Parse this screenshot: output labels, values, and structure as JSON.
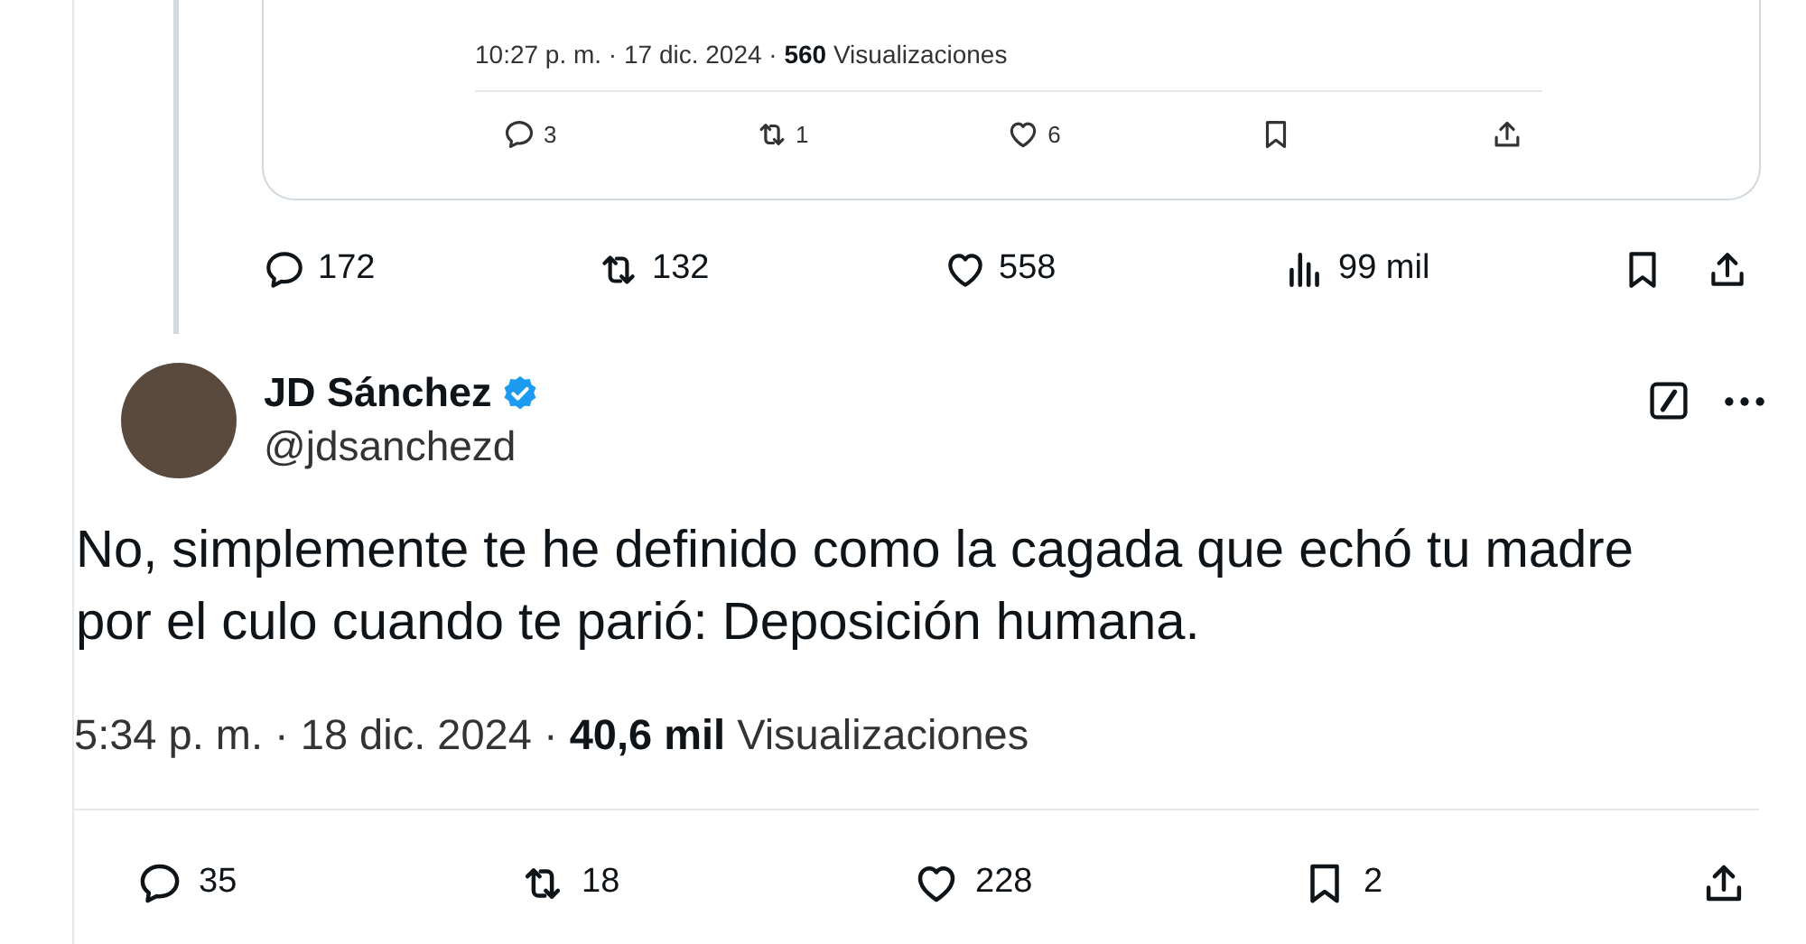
{
  "quoted_tweet": {
    "meta": "10:27 p. m. · 17 dic. 2024 · **560** Visualizaciones",
    "actions": [
      {
        "kind": "reply",
        "count": "3"
      },
      {
        "kind": "repost",
        "count": "1"
      },
      {
        "kind": "like",
        "count": "6"
      },
      {
        "kind": "bookmark"
      },
      {
        "kind": "share"
      }
    ]
  },
  "parent_actions": [
    {
      "kind": "reply",
      "count": "172"
    },
    {
      "kind": "repost",
      "count": "132"
    },
    {
      "kind": "like",
      "count": "558"
    },
    {
      "kind": "views",
      "count": "99 mil"
    },
    {
      "kind": "bookmark"
    },
    {
      "kind": "share"
    }
  ],
  "reply": {
    "name": "JD Sánchez",
    "verified": true,
    "handle": "@jdsanchezd",
    "text": "No, simplemente te he definido como la cagada que echó tu madre por el culo cuando te parió: Deposición humana.",
    "meta": "5:34 p. m. · 18 dic. 2024 · **40,6 mil** Visualizaciones",
    "actions": [
      {
        "kind": "reply",
        "count": "35"
      },
      {
        "kind": "repost",
        "count": "18"
      },
      {
        "kind": "like",
        "count": "228"
      },
      {
        "kind": "bookmark",
        "count": "2"
      },
      {
        "kind": "share"
      }
    ]
  }
}
